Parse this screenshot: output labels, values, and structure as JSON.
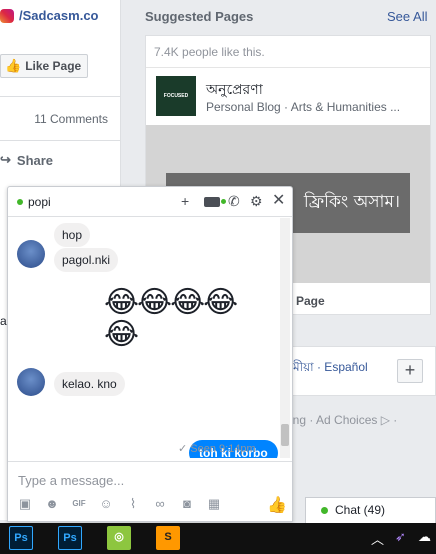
{
  "left_post": {
    "page_name": "/Sadcasm.co",
    "like_page_label": "Like Page",
    "comments_label": "11 Comments",
    "share_label": "Share",
    "partial_chars": "al"
  },
  "sidebar": {
    "suggested_title": "Suggested Pages",
    "see_all_label": "See All",
    "people_like": "7.4K people like this.",
    "page_title": "অনুপ্রেরণা",
    "page_category": "Personal Blog · Arts & Humanities ...",
    "logo_text": "FOCUSED",
    "image_text": "ফ্রিকিং অসাম।",
    "like_page_label": "Page",
    "lang_text": "মীয়া · Español",
    "lang_plus": "+",
    "footer_links": "ing · Ad Choices ▷ ·"
  },
  "chat": {
    "contact_name": "popi",
    "messages": [
      {
        "text": "hop"
      },
      {
        "text": "pagol.nki"
      },
      {
        "text": "😂😂😂😂"
      },
      {
        "text": "😂"
      },
      {
        "text": "kelao. kno"
      },
      {
        "text": "toh ki korbo"
      }
    ],
    "seen_text": "Seen 9:14pm",
    "compose_placeholder": "Type a message...",
    "tool_icons": [
      "image-icon",
      "sticker-icon",
      "gif-icon",
      "emoji-icon",
      "attach-icon",
      "link-icon",
      "camera-icon",
      "grid-icon"
    ]
  },
  "chat_tab": {
    "label": "Chat (49)"
  },
  "taskbar": {
    "apps": [
      {
        "label": "Ps",
        "bg": "#001e36",
        "fg": "#31a8ff"
      },
      {
        "label": "Ps",
        "bg": "#001e36",
        "fg": "#31a8ff"
      },
      {
        "label": "◎",
        "bg": "#8dc63f",
        "fg": "#ffffff"
      },
      {
        "label": "S",
        "bg": "#ff9800",
        "fg": "#222222"
      }
    ]
  },
  "colors": {
    "brand_blue": "#365899",
    "messenger_blue": "#0084ff",
    "online_green": "#42b72a"
  }
}
